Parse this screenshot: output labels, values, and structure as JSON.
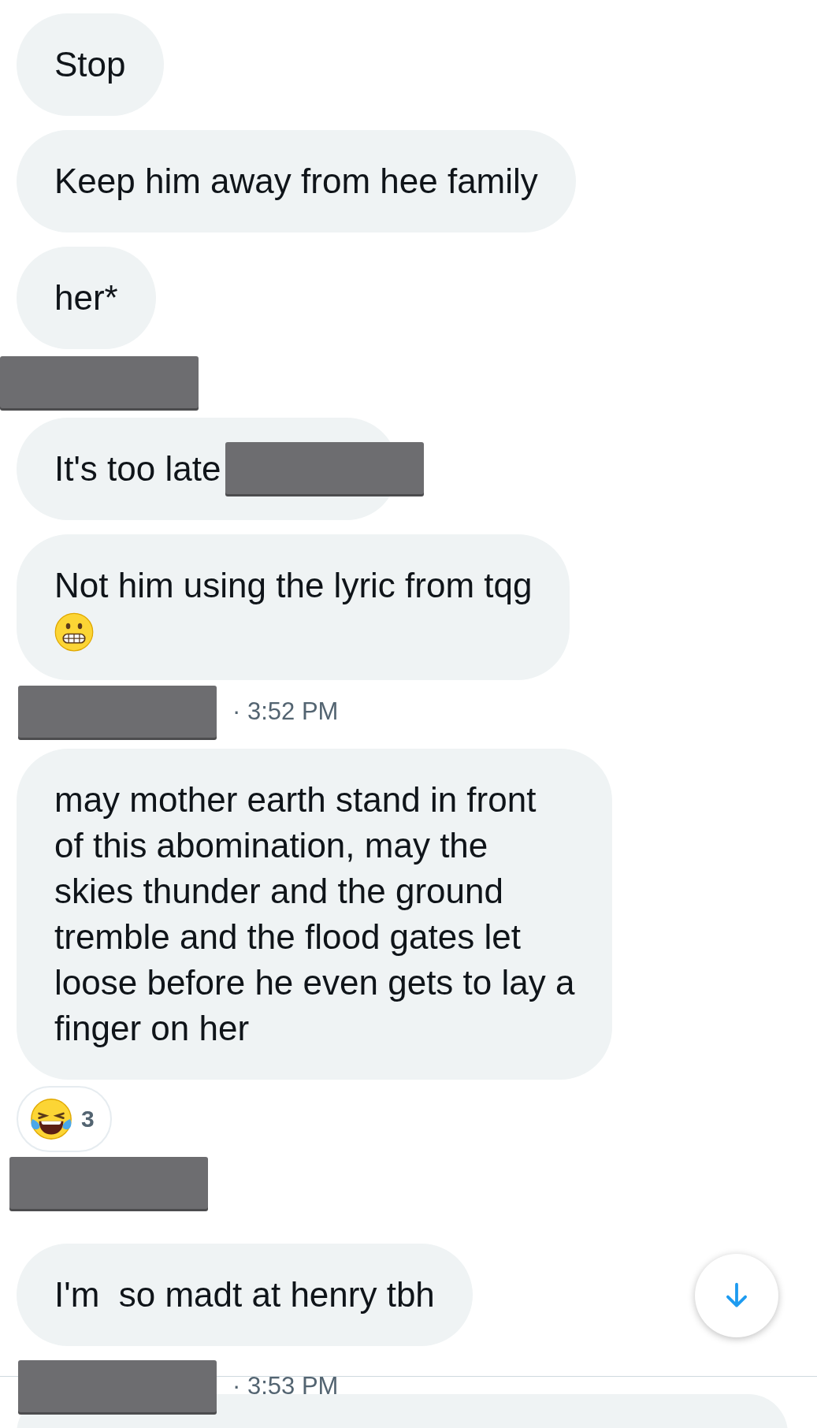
{
  "messages": [
    {
      "kind": "bubble",
      "lines": [
        "Stop"
      ]
    },
    {
      "kind": "bubble",
      "lines": [
        "Keep him away from hee family"
      ]
    },
    {
      "kind": "bubble",
      "lines": [
        "her*"
      ]
    },
    {
      "kind": "redaction"
    },
    {
      "kind": "bubble",
      "lines": [
        "It's too late"
      ],
      "redacted": true
    },
    {
      "kind": "bubble",
      "lines": [
        "Not him using the lyric from tqg"
      ],
      "emoji": {
        "kind": "grimace"
      }
    },
    {
      "kind": "meta",
      "time": "· 3:52 PM",
      "redacted": true
    },
    {
      "kind": "bubble",
      "lines": [
        "may mother earth stand in front",
        "of this abomination, may the",
        "skies thunder and the ground",
        "tremble and the flood gates let",
        "loose before he even gets to lay a",
        "finger on her"
      ]
    },
    {
      "kind": "reaction",
      "emoji": {
        "kind": "laugh"
      },
      "count": "3"
    },
    {
      "kind": "redaction"
    },
    {
      "kind": "bubble",
      "lines": [
        "I'm  so madt at henry tbh"
      ]
    },
    {
      "kind": "meta",
      "time": "· 3:53 PM",
      "redacted": true
    }
  ]
}
